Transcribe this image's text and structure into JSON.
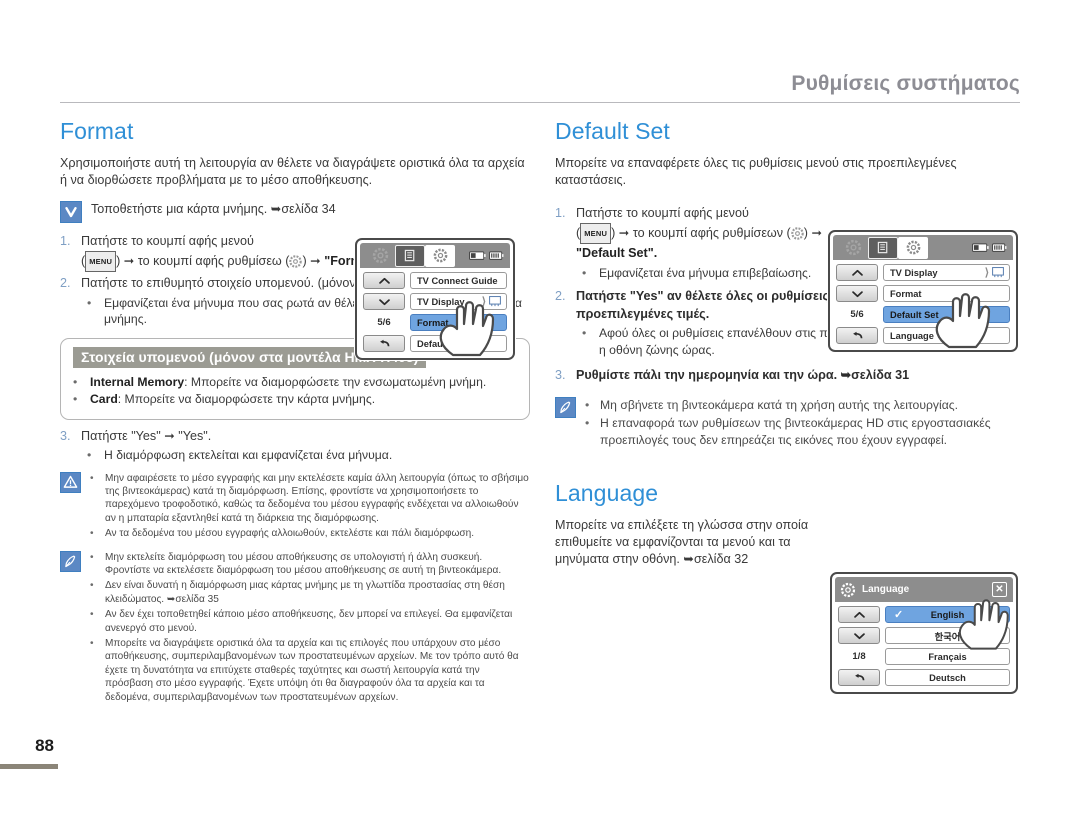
{
  "header": {
    "title": "Ρυθμίσεις συστήματος"
  },
  "footer": {
    "page_number": "88"
  },
  "colors": {
    "heading_blue": "#2f8fd6",
    "header_gray": "#8d8d94",
    "callout_title_bg": "#9b9b93",
    "lcd_selected": "#6fa4e0",
    "icon_blue": "#5b88c4",
    "page_bar": "#8b8578"
  },
  "format": {
    "heading": "Format",
    "intro": "Χρησιμοποιήστε αυτή τη λειτουργία αν θέλετε να διαγράψετε οριστικά όλα τα αρχεία ή να διορθώσετε προβλήματα με το μέσο αποθήκευσης.",
    "prereq_note": "Τοποθετήστε μια κάρτα μνήμης. ➥σελίδα 34",
    "steps": [
      {
        "num": "1.",
        "text_pre": "Πατήστε το κουμπί αφής μενού",
        "text_mid": ") ➞ το κουμπί αφής ρυθμίσεω (",
        "menu_chip": "MENU",
        "text_post": ") ➞ ",
        "target": "\"Format\"."
      },
      {
        "num": "2.",
        "text": "Πατήστε το επιθυμητό στοιχείο υπομενού. (μόνον στα μοντέλα HMX-H405)",
        "bullets": [
          "Εμφανίζεται ένα μήνυμα που σας ρωτά αν θέλετε να διαμορφώσετε την κάρτα μνήμης."
        ]
      },
      {
        "num": "3.",
        "text": "Πατήστε \"Yes\" ➞ \"Yes\".",
        "bullets": [
          "Η διαμόρφωση εκτελείται και εμφανίζεται ένα μήνυμα."
        ]
      }
    ],
    "callout": {
      "title": "Στοιχεία υπομενού (μόνον στα μοντέλα HMX-H405)",
      "items": [
        {
          "label": "Internal Memory",
          "text": ": Μπορείτε να διαμορφώσετε την ενσωματωμένη μνήμη."
        },
        {
          "label": "Card",
          "text": ": Μπορείτε να διαμορφώσετε την κάρτα μνήμης."
        }
      ]
    },
    "warning_block": [
      "Μην αφαιρέσετε το μέσο εγγραφής και μην εκτελέσετε καμία άλλη λειτουργία (όπως το σβήσιμο της βιντεοκάμερας) κατά τη διαμόρφωση. Επίσης, φροντίστε να χρησιμοποιήσετε το παρεχόμενο τροφοδοτικό, καθώς τα δεδομένα του μέσου εγγραφής ενδέχεται να αλλοιωθούν αν η μπαταρία εξαντληθεί κατά τη διάρκεια της διαμόρφωσης.",
      "Αν τα δεδομένα του μέσου εγγραφής αλλοιωθούν, εκτελέστε και πάλι διαμόρφωση."
    ],
    "note_block": [
      "Μην εκτελείτε διαμόρφωση του μέσου αποθήκευσης σε υπολογιστή ή άλλη συσκευή. Φροντίστε να εκτελέσετε διαμόρφωση του μέσου αποθήκευσης σε αυτή τη βιντεοκάμερα.",
      "Δεν είναι δυνατή η διαμόρφωση μιας κάρτας μνήμης με τη γλωττίδα προστασίας στη θέση κλειδώματος. ➥σελίδα 35",
      "Αν δεν έχει τοποθετηθεί κάποιο μέσο αποθήκευσης, δεν μπορεί να επιλεγεί. Θα εμφανίζεται ανενεργό στο μενού.",
      "Μπορείτε να διαγράψετε οριστικά όλα τα αρχεία και τις επιλογές που υπάρχουν στο μέσο αποθήκευσης, συμπεριλαμβανομένων των προστατευμένων αρχείων. Με τον τρόπο αυτό θα έχετε τη δυνατότητα να επιτύχετε σταθερές ταχύτητες και σωστή λειτουργία κατά την πρόσβαση στο μέσο εγγραφής. Έχετε υπόψη ότι θα διαγραφούν όλα τα αρχεία και τα δεδομένα, συμπεριλαμβανομένων των προστατευμένων αρχείων."
    ],
    "lcd": {
      "page_indicator": "5/6",
      "items": [
        {
          "label": "TV Connect Guide",
          "selected": false,
          "right_icon": ""
        },
        {
          "label": "TV Display",
          "selected": false,
          "right_icon": "tv-display-icon"
        },
        {
          "label": "Format",
          "selected": true,
          "right_icon": ""
        },
        {
          "label": "Default Set",
          "selected": false,
          "right_icon": ""
        }
      ],
      "buttons": [
        "up-arrow-button",
        "down-arrow-button",
        "page-indicator",
        "back-button"
      ]
    }
  },
  "default_set": {
    "heading": "Default Set",
    "intro": "Μπορείτε να επαναφέρετε όλες τις ρυθμίσεις μενού στις προεπιλεγμένες καταστάσεις.",
    "steps": [
      {
        "num": "1.",
        "text_pre": "Πατήστε το κουμπί αφής μενού",
        "menu_chip": "MENU",
        "text_mid": ") ➞ το κουμπί αφής ρυθμίσεων (",
        "text_post": ") ➞ ",
        "target": "\"Default Set\".",
        "bullets": [
          "Εμφανίζεται ένα μήνυμα επιβεβαίωσης."
        ]
      },
      {
        "num": "2.",
        "text": "Πατήστε \"Yes\" αν θέλετε όλες οι ρυθμίσεις να επανέλθουν στις προεπιλεγμένες τιμές.",
        "bold": true,
        "bullets": [
          "Αφού όλες οι ρυθμίσεις επανέλθουν στις προεπιλεγμένες τιμές, εμφανίζεται η οθόνη ζώνης ώρας."
        ]
      },
      {
        "num": "3.",
        "text": "Ρυθμίστε πάλι την ημερομηνία και την ώρα. ➥σελίδα 31",
        "bold": true
      }
    ],
    "note_block": [
      "Μη σβήνετε τη βιντεοκάμερα κατά τη χρήση αυτής της λειτουργίας.",
      "Η επαναφορά των ρυθμίσεων της βιντεοκάμερας HD στις εργοστασιακές προεπιλογές τους δεν επηρεάζει τις εικόνες που έχουν εγγραφεί."
    ],
    "lcd": {
      "page_indicator": "5/6",
      "items": [
        {
          "label": "TV Display",
          "selected": false,
          "right_icon": "tv-display-icon"
        },
        {
          "label": "Format",
          "selected": false,
          "right_icon": ""
        },
        {
          "label": "Default Set",
          "selected": true,
          "right_icon": ""
        },
        {
          "label": "Language",
          "selected": false,
          "right_icon": ""
        }
      ]
    }
  },
  "language": {
    "heading": "Language",
    "intro": "Μπορείτε να επιλέξετε τη γλώσσα στην οποία επιθυμείτε να εμφανίζονται τα μενού και τα μηνύματα στην οθόνη. ➥σελίδα 32",
    "lcd": {
      "dialog_title": "Language",
      "page_indicator": "1/8",
      "items": [
        {
          "label": "English",
          "selected": true,
          "checked": true
        },
        {
          "label": "한국어",
          "selected": false,
          "checked": false
        },
        {
          "label": "Français",
          "selected": false,
          "checked": false
        },
        {
          "label": "Deutsch",
          "selected": false,
          "checked": false
        }
      ]
    }
  }
}
